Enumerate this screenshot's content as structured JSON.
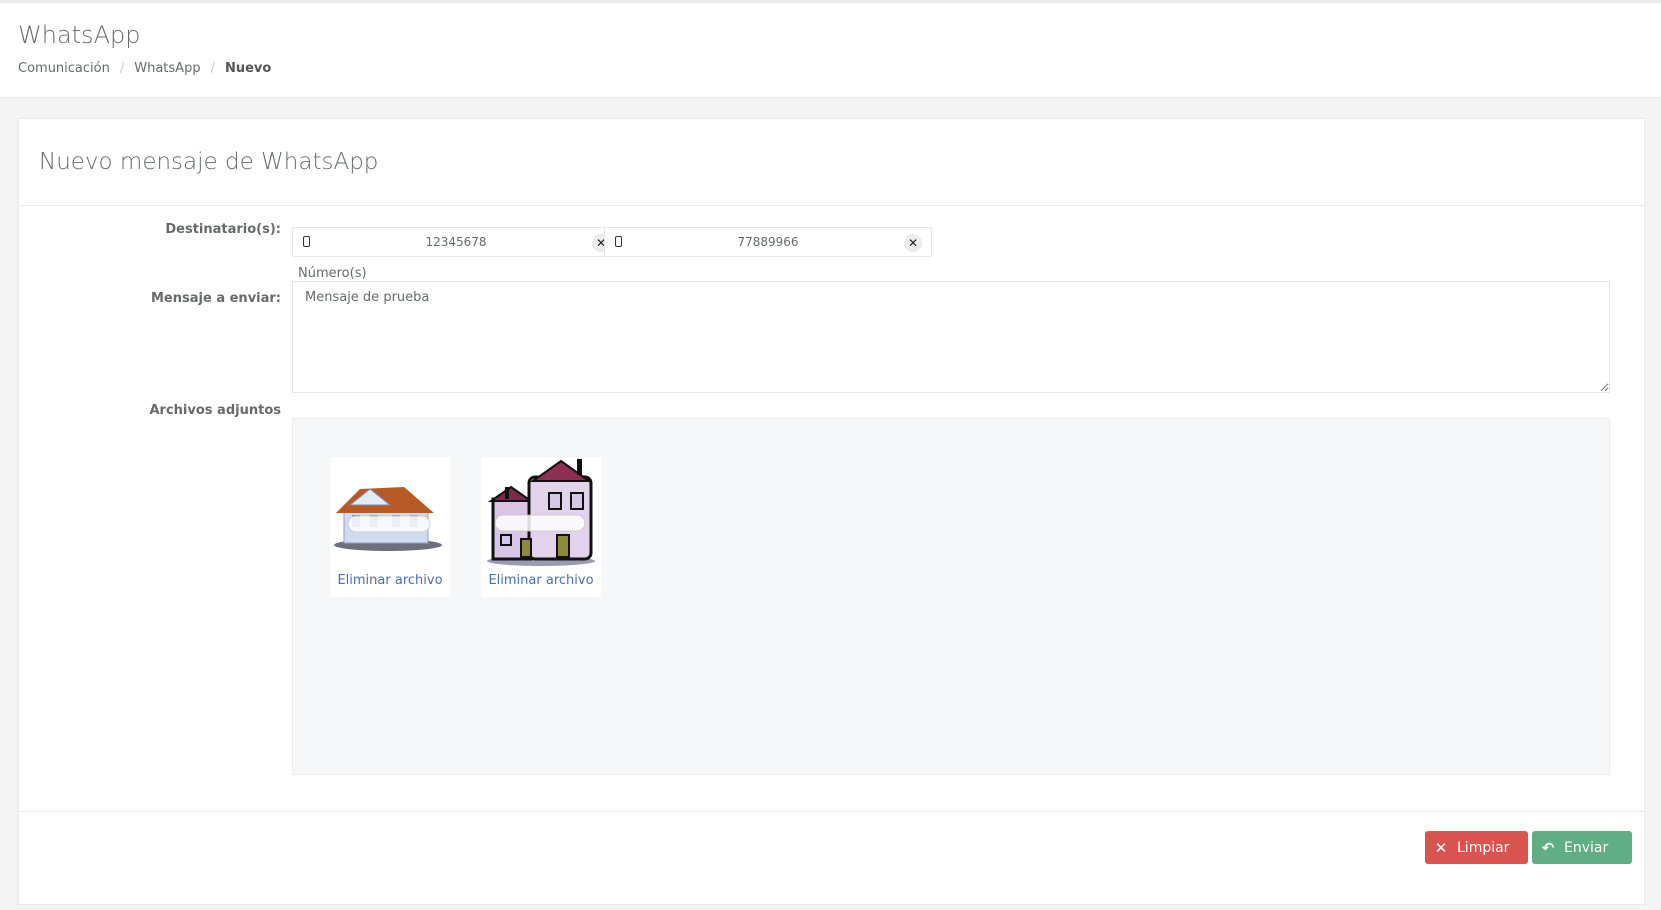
{
  "header": {
    "title": "WhatsApp",
    "breadcrumb": [
      "Comunicación",
      "WhatsApp",
      "Nuevo"
    ]
  },
  "panel": {
    "title": "Nuevo mensaje de WhatsApp"
  },
  "form": {
    "recipients_label": "Destinatario(s):",
    "recipients": [
      {
        "number": "12345678"
      },
      {
        "number": "77889966"
      }
    ],
    "numbers_placeholder": "Número(s)",
    "message_label": "Mensaje a enviar:",
    "message_value": "Mensaje de prueba",
    "attachments_label": "Archivos adjuntos",
    "attachments": [
      {
        "remove_label": "Eliminar archivo",
        "icon": "house-image-icon"
      },
      {
        "remove_label": "Eliminar archivo",
        "icon": "building-image-icon"
      }
    ]
  },
  "footer": {
    "clear_label": "Limpiar",
    "send_label": "Enviar"
  },
  "colors": {
    "danger": "#d9534f",
    "primary": "#5fae84",
    "link": "#4a6fa5"
  }
}
